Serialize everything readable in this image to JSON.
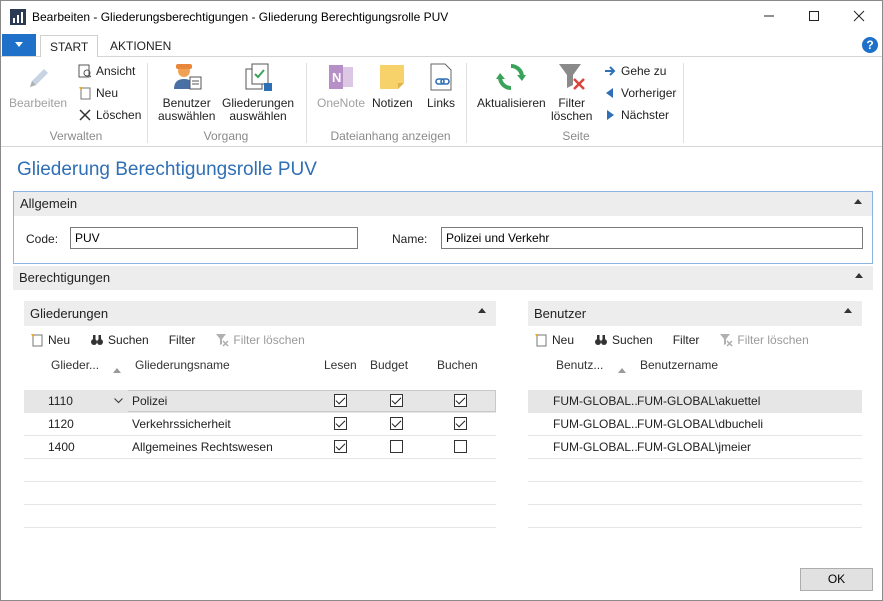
{
  "window": {
    "title": "Bearbeiten - Gliederungsberechtigungen - Gliederung Berechtigungsrolle PUV"
  },
  "ribbon_tabs": [
    {
      "label": "START"
    },
    {
      "label": "AKTIONEN"
    }
  ],
  "ribbon": {
    "verwalten": {
      "label": "Verwalten",
      "bearbeiten": "Bearbeiten",
      "ansicht": "Ansicht",
      "neu": "Neu",
      "loeschen": "Löschen"
    },
    "vorgang": {
      "label": "Vorgang",
      "benutzer_1": "Benutzer",
      "benutzer_2": "auswählen",
      "gliederungen_1": "Gliederungen",
      "gliederungen_2": "auswählen"
    },
    "dateianhang": {
      "label": "Dateianhang anzeigen",
      "onenote": "OneNote",
      "notizen": "Notizen",
      "links": "Links"
    },
    "seite": {
      "label": "Seite",
      "aktualisieren": "Aktualisieren",
      "filter_1": "Filter",
      "filter_2": "löschen",
      "gehe_zu": "Gehe zu",
      "vorheriger": "Vorheriger",
      "naechster": "Nächster"
    }
  },
  "page_title": "Gliederung Berechtigungsrolle PUV",
  "allgemein": {
    "label": "Allgemein",
    "code_label": "Code:",
    "code_value": "PUV",
    "name_label": "Name:",
    "name_value": "Polizei und Verkehr"
  },
  "berechtigungen": {
    "label": "Berechtigungen"
  },
  "gliederungen": {
    "label": "Gliederungen",
    "toolbar": {
      "neu": "Neu",
      "suchen": "Suchen",
      "filter": "Filter",
      "filter_loeschen": "Filter löschen"
    },
    "columns": {
      "code": "Glieder...",
      "name": "Gliederungsname",
      "lesen": "Lesen",
      "budget": "Budget",
      "buchen": "Buchen"
    },
    "rows": [
      {
        "code": "1110",
        "name": "Polizei",
        "lesen": true,
        "budget": true,
        "buchen": true,
        "selected": true
      },
      {
        "code": "1120",
        "name": "Verkehrssicherheit",
        "lesen": true,
        "budget": true,
        "buchen": true,
        "selected": false
      },
      {
        "code": "1400",
        "name": "Allgemeines Rechtswesen",
        "lesen": true,
        "budget": false,
        "buchen": false,
        "selected": false
      }
    ]
  },
  "benutzer": {
    "label": "Benutzer",
    "toolbar": {
      "neu": "Neu",
      "suchen": "Suchen",
      "filter": "Filter",
      "filter_loeschen": "Filter löschen"
    },
    "columns": {
      "id": "Benutz...",
      "name": "Benutzername"
    },
    "rows": [
      {
        "id": "FUM-GLOBAL...",
        "name": "FUM-GLOBAL\\akuettel",
        "selected": true
      },
      {
        "id": "FUM-GLOBAL...",
        "name": "FUM-GLOBAL\\dbucheli",
        "selected": false
      },
      {
        "id": "FUM-GLOBAL...",
        "name": "FUM-GLOBAL\\jmeier",
        "selected": false
      }
    ]
  },
  "ok_button": "OK",
  "colors": {
    "accent": "#1e70c8",
    "title_blue": "#2f6fb5",
    "green": "#3aa35a",
    "red": "#d9453b"
  }
}
